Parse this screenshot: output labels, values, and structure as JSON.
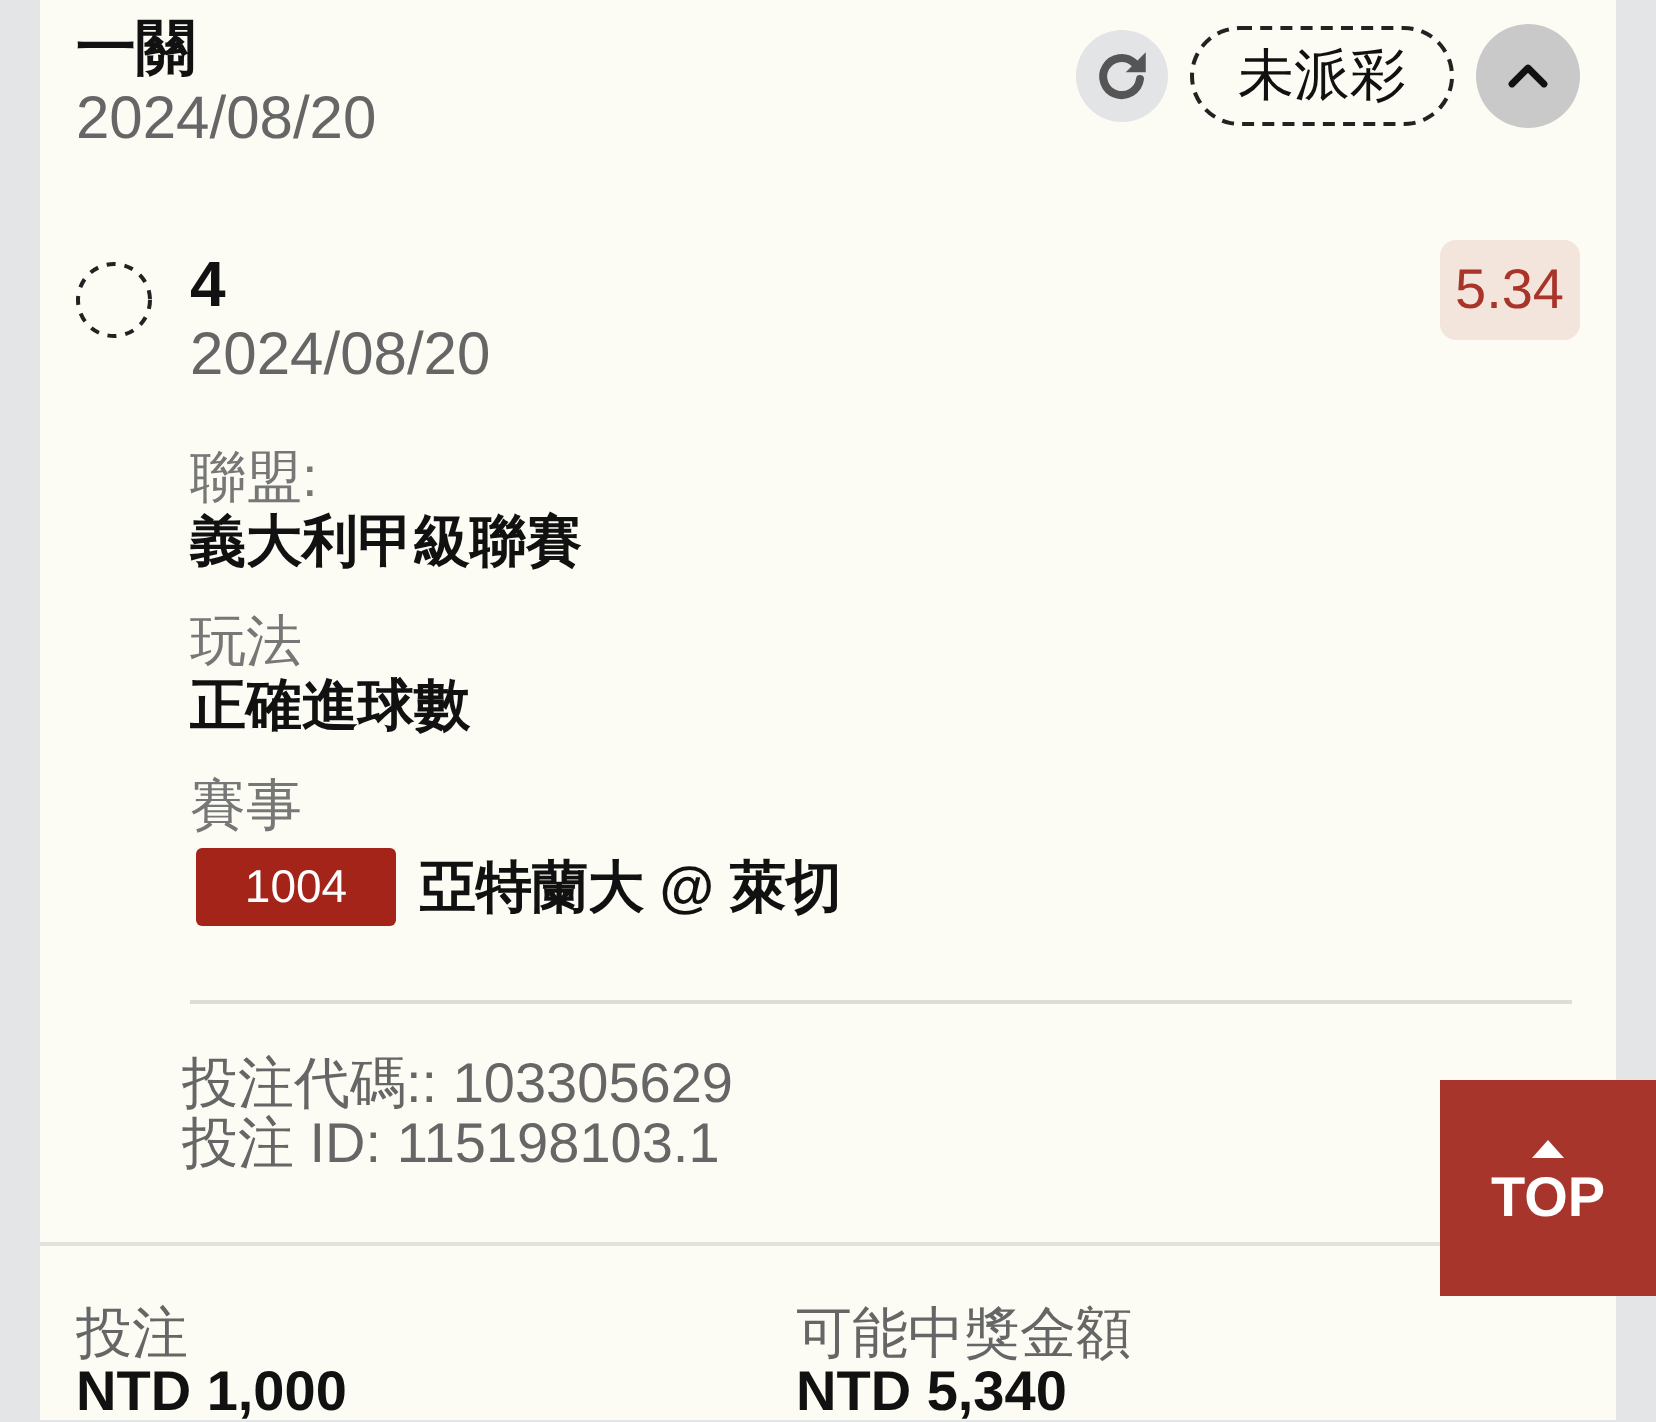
{
  "bet": {
    "title": "一關",
    "date": "2024/08/20",
    "status": "未派彩",
    "expanded": true
  },
  "leg": {
    "selection": "4",
    "date": "2024/08/20",
    "odds": "5.34",
    "fields": [
      {
        "kind": "text",
        "label": "聯盟:",
        "value": "義大利甲級聯賽"
      },
      {
        "kind": "text",
        "label": "玩法",
        "value": "正確進球數"
      },
      {
        "kind": "match",
        "label": "賽事",
        "code": "1004",
        "value": "亞特蘭大 @ 萊切"
      }
    ]
  },
  "references": [
    "投注代碼:: 103305629",
    "投注 ID: 115198103.1"
  ],
  "totals": [
    {
      "label": "投注",
      "value": "NTD 1,000"
    },
    {
      "label": "可能中獎金額",
      "value": "NTD 5,340"
    }
  ],
  "top_button": {
    "label": "TOP"
  }
}
